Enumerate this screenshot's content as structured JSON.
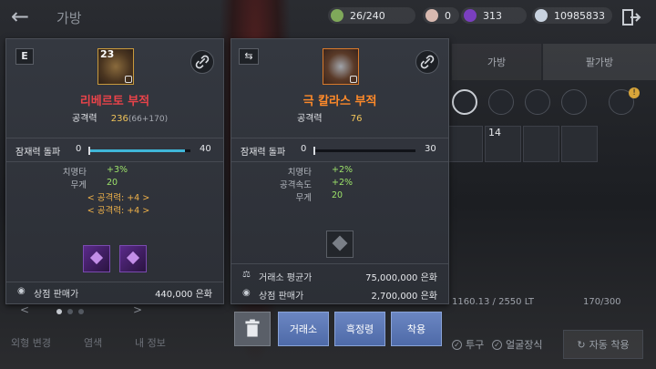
{
  "topbar": {
    "back_icon": "back-arrow-icon",
    "title": "가방",
    "slots": "26/240",
    "pearls": "0",
    "gems": "313",
    "silver": "10985833",
    "exit_icon": "exit-icon"
  },
  "bag_tabs": {
    "bag": "가방",
    "warehouse": "팔가방"
  },
  "inventory": {
    "slot_counts": [
      "14"
    ],
    "weight": "1160.13 / 2550 LT",
    "capacity": "170/300"
  },
  "bottom_left": {
    "appearance": "외형 변경",
    "dye": "염색",
    "my_info": "내 정보"
  },
  "bottom_right": {
    "helmet": "투구",
    "face_deco": "얼굴장식",
    "auto_equip": "자동 착용"
  },
  "colors": {
    "accent_red": "#e8434a",
    "accent_orange": "#ff8a2a",
    "gold": "#f0c45a",
    "green": "#9de36a",
    "bar_cyan": "#3fb6d8",
    "button_blue": "#5e79b6"
  },
  "equipped": {
    "badge": "E",
    "level": "23",
    "name": "리베르토 부적",
    "stat_label": "공격력",
    "stat_value": "236",
    "stat_breakdown": "(66+170)",
    "potential_label": "잠재력 돌파",
    "potential_min": "0",
    "potential_max": "40",
    "potential_progress": 0.95,
    "options": [
      {
        "k": "치명타",
        "v": "+3%"
      },
      {
        "k": "무게",
        "v": "20"
      }
    ],
    "set_effects": [
      "< 공격력: +4 >",
      "< 공격력: +4 >"
    ],
    "shop_price_label": "상점 판매가",
    "shop_price": "440,000 은화"
  },
  "compared": {
    "badge_icon": "swap-icon",
    "name": "극 칼라스 부적",
    "stat_label": "공격력",
    "stat_value": "76",
    "potential_label": "잠재력 돌파",
    "potential_min": "0",
    "potential_max": "30",
    "potential_progress": 0,
    "options": [
      {
        "k": "치명타",
        "v": "+2%"
      },
      {
        "k": "공격속도",
        "v": "+2%"
      },
      {
        "k": "무게",
        "v": "20"
      }
    ],
    "market_avg_label": "거래소 평균가",
    "market_avg": "75,000,000 은화",
    "shop_price_label": "상점 판매가",
    "shop_price": "2,700,000 은화"
  },
  "actions": {
    "trash_icon": "trash-icon",
    "market": "거래소",
    "black_spirit": "흑정령",
    "equip": "착용"
  }
}
